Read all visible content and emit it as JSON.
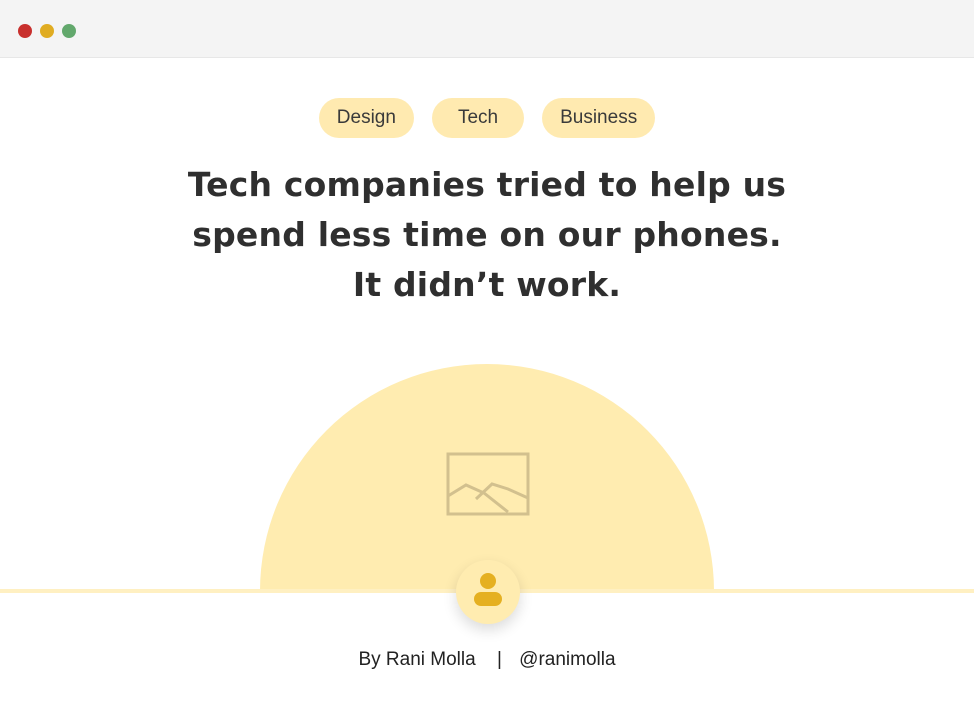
{
  "window": {
    "controls": [
      {
        "name": "close",
        "color": "#c8302d"
      },
      {
        "name": "minimize",
        "color": "#e0ac22"
      },
      {
        "name": "maximize",
        "color": "#62a86c"
      }
    ]
  },
  "tags": [
    "Design",
    "Tech",
    "Business"
  ],
  "article": {
    "headline": "Tech companies tried to help us spend less time on our phones. It didn’t work.",
    "image_icon": "image-placeholder-icon",
    "author_icon": "user-icon"
  },
  "byline": {
    "author": "By Rani Molla",
    "separator": "|",
    "handle": "@ranimolla"
  },
  "colors": {
    "accent": "#ffecb0",
    "icon_accent": "#e5b021",
    "text": "#2f2f2f"
  }
}
